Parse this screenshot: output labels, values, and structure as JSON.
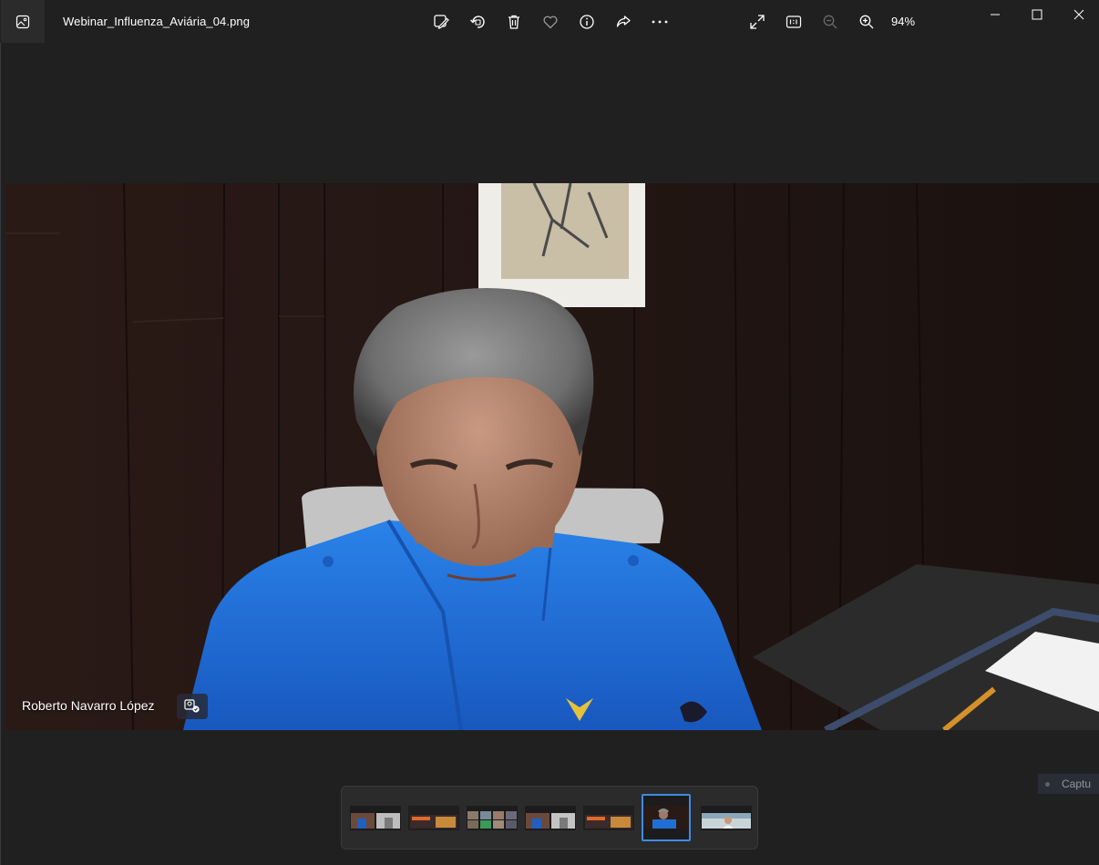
{
  "titlebar": {
    "filename": "Webinar_Influenza_Aviária_04.png",
    "zoom_level": "94%"
  },
  "toolbar": {
    "buttons": [
      "edit-image",
      "rotate",
      "delete",
      "favorite",
      "file-info",
      "share",
      "see-more"
    ],
    "view_buttons": [
      "full-screen",
      "actual-size",
      "zoom-out",
      "zoom-in"
    ]
  },
  "window_controls": [
    "minimize",
    "maximize",
    "close"
  ],
  "photo": {
    "participant_name": "Roberto Navarro López"
  },
  "filmstrip": {
    "count": 7,
    "selected_index": 5
  },
  "capture_chip": {
    "label": "Captu"
  },
  "colors": {
    "background": "#202020",
    "selection_accent": "#3c8ce6",
    "shirt_blue": "#1f6fd6"
  }
}
